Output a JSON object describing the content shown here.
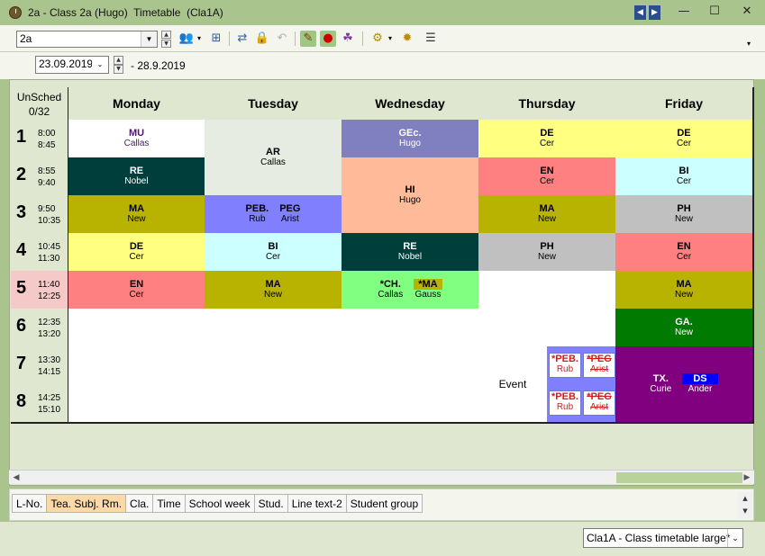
{
  "window": {
    "title": "2a - Class 2a (Hugo)  Timetable  (Cla1A)",
    "nav_prev": "◀",
    "nav_next": "▶",
    "minimize": "—",
    "maximize": "☐",
    "close": "✕"
  },
  "toolbar": {
    "class_select_value": "2a"
  },
  "date": {
    "start_value": "23.09.2019",
    "range_text": "- 28.9.2019"
  },
  "grid": {
    "unscheduled_label": "UnSched",
    "unscheduled_count": "0/32",
    "days": [
      "Monday",
      "Tuesday",
      "Wednesday",
      "Thursday",
      "Friday"
    ],
    "periods": [
      {
        "num": "1",
        "start": "8:00",
        "end": "8:45"
      },
      {
        "num": "2",
        "start": "8:55",
        "end": "9:40"
      },
      {
        "num": "3",
        "start": "9:50",
        "end": "10:35"
      },
      {
        "num": "4",
        "start": "10:45",
        "end": "11:30"
      },
      {
        "num": "5",
        "start": "11:40",
        "end": "12:25"
      },
      {
        "num": "6",
        "start": "12:35",
        "end": "13:20"
      },
      {
        "num": "7",
        "start": "13:30",
        "end": "14:15"
      },
      {
        "num": "8",
        "start": "14:25",
        "end": "15:10"
      }
    ],
    "lessons": {
      "mon_1": {
        "subject": "MU",
        "teacher": "Callas"
      },
      "mon_2": {
        "subject": "RE",
        "teacher": "Nobel"
      },
      "mon_3": {
        "subject": "MA",
        "teacher": "New"
      },
      "mon_4": {
        "subject": "DE",
        "teacher": "Cer"
      },
      "mon_5": {
        "subject": "EN",
        "teacher": "Cer"
      },
      "tue_1": {
        "subject": "AR",
        "teacher": "Callas"
      },
      "tue_3a": {
        "subject": "PEB.",
        "teacher": "Rub"
      },
      "tue_3b": {
        "subject": "PEG",
        "teacher": "Arist"
      },
      "tue_4": {
        "subject": "BI",
        "teacher": "Cer"
      },
      "tue_5": {
        "subject": "MA",
        "teacher": "New"
      },
      "wed_1": {
        "subject": "GEc.",
        "teacher": "Hugo"
      },
      "wed_2": {
        "subject": "HI",
        "teacher": "Hugo"
      },
      "wed_4": {
        "subject": "RE",
        "teacher": "Nobel"
      },
      "wed_5a": {
        "subject": "*CH.",
        "teacher": "Callas"
      },
      "wed_5b": {
        "subject": "*MA",
        "teacher": "Gauss"
      },
      "thu_1": {
        "subject": "DE",
        "teacher": "Cer"
      },
      "thu_2": {
        "subject": "EN",
        "teacher": "Cer"
      },
      "thu_3": {
        "subject": "MA",
        "teacher": "New"
      },
      "thu_4": {
        "subject": "PH",
        "teacher": "New"
      },
      "thu_7": {
        "event": "Event"
      },
      "thu_7a": {
        "subject": "*PEB.",
        "teacher": "Rub"
      },
      "thu_7b": {
        "subject": "*PEG",
        "teacher": "Arist"
      },
      "thu_8a": {
        "subject": "*PEB.",
        "teacher": "Rub"
      },
      "thu_8b": {
        "subject": "*PEG",
        "teacher": "Arist"
      },
      "fri_1": {
        "subject": "DE",
        "teacher": "Cer"
      },
      "fri_2": {
        "subject": "BI",
        "teacher": "Cer"
      },
      "fri_3": {
        "subject": "PH",
        "teacher": "New"
      },
      "fri_4": {
        "subject": "EN",
        "teacher": "Cer"
      },
      "fri_5": {
        "subject": "MA",
        "teacher": "New"
      },
      "fri_6": {
        "subject": "GA.",
        "teacher": "New"
      },
      "fri_7a": {
        "subject": "TX.",
        "teacher": "Curie"
      },
      "fri_7b": {
        "subject": "DS",
        "teacher": "Ander"
      }
    }
  },
  "tabs": [
    "L-No.",
    "Tea. Subj. Rm.",
    "Cla.",
    "Time",
    "School week",
    "Stud.",
    "Line text-2",
    "Student group"
  ],
  "layout_select": "Cla1A - Class timetable large*"
}
